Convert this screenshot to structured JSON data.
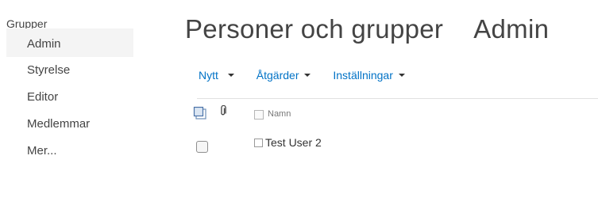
{
  "sidebar": {
    "heading": "Grupper",
    "items": [
      {
        "label": "Admin",
        "selected": true
      },
      {
        "label": "Styrelse"
      },
      {
        "label": "Editor"
      },
      {
        "label": "Medlemmar"
      },
      {
        "label": "Mer..."
      }
    ]
  },
  "header": {
    "title": "Personer och grupper",
    "group_name": "Admin"
  },
  "toolbar": {
    "new_label": "Nytt",
    "actions_label": "Åtgärder",
    "settings_label": "Inställningar"
  },
  "list": {
    "columns": {
      "name_label": "Namn"
    },
    "rows": [
      {
        "name": "Test User 2"
      }
    ]
  },
  "colors": {
    "accent": "#0072c6",
    "text": "#444444",
    "selected_bg": "#f4f4f4"
  }
}
